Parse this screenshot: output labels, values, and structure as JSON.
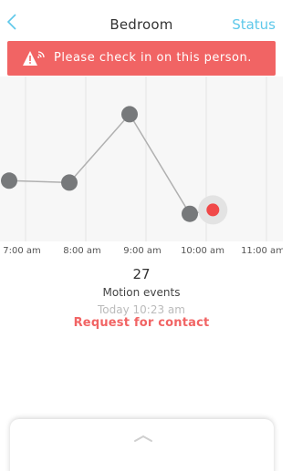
{
  "header": {
    "title": "Bedroom",
    "status_label": "Status"
  },
  "alert": {
    "message": "Please check in on this person.",
    "icon": "warning-wifi-icon"
  },
  "chart_data": {
    "type": "line",
    "x": [
      "7:00 am",
      "8:00 am",
      "9:00 am",
      "10:00 am",
      "11:00 am"
    ],
    "points": [
      {
        "x": "7:00 am",
        "y": 2.6,
        "highlight": false
      },
      {
        "x": "8:00 am",
        "y": 2.5,
        "highlight": false
      },
      {
        "x": "9:00 am",
        "y": 6.0,
        "highlight": false
      },
      {
        "x": "10:00 am",
        "y": 0.9,
        "highlight": false
      },
      {
        "x": "10:23 am",
        "y": 1.1,
        "highlight": true
      }
    ],
    "ylim": [
      0,
      7
    ],
    "grid": "vertical",
    "colors": {
      "point": "#77797b",
      "highlight": "#f04848",
      "line": "#b0b0b0"
    }
  },
  "readout": {
    "count": "27",
    "label": "Motion events",
    "timestamp": "Today 10:23 am",
    "action": "Request for contact"
  },
  "colors": {
    "accent": "#5ec8ea",
    "alert": "#f16464"
  }
}
